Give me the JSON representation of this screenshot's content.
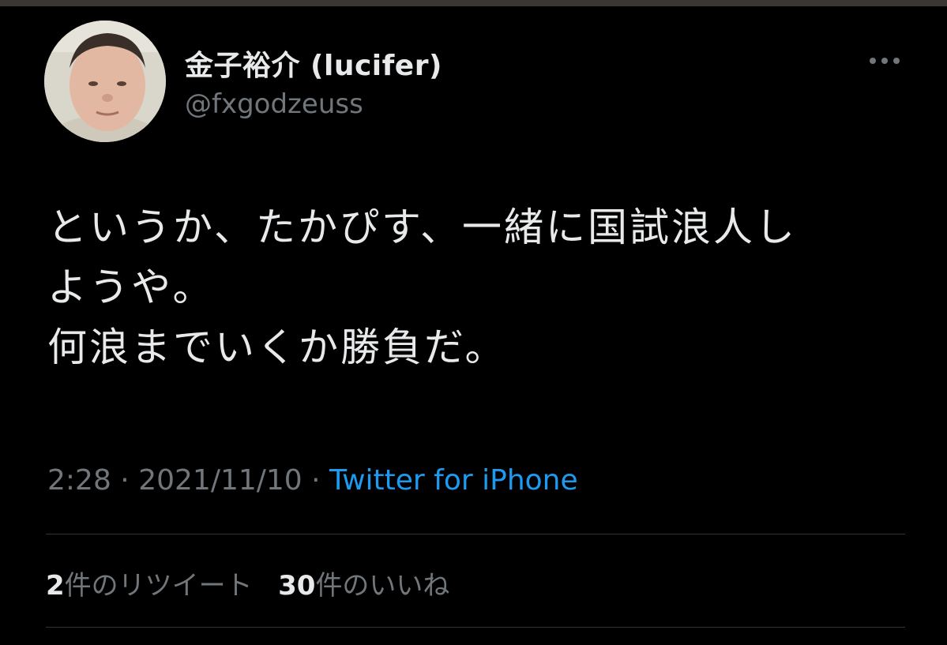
{
  "tweet": {
    "author": {
      "display_name": "金子裕介 (lucifer)",
      "handle": "@fxgodzeuss"
    },
    "text": "というか、たかぴす、一緒に国試浪人し\nようや。\n何浪までいくか勝負だ。",
    "time": "2:28",
    "date": "2021/11/10",
    "separator": "·",
    "source": "Twitter for iPhone",
    "retweets": {
      "count": "2",
      "label": "件のリツイート"
    },
    "likes": {
      "count": "30",
      "label": "件のいいね"
    }
  },
  "colors": {
    "background": "#000000",
    "text": "#e7e9ea",
    "muted": "#71767b",
    "link": "#1d9bf0",
    "divider": "#2f3336"
  },
  "icons": {
    "more": "more-horizontal-icon"
  }
}
